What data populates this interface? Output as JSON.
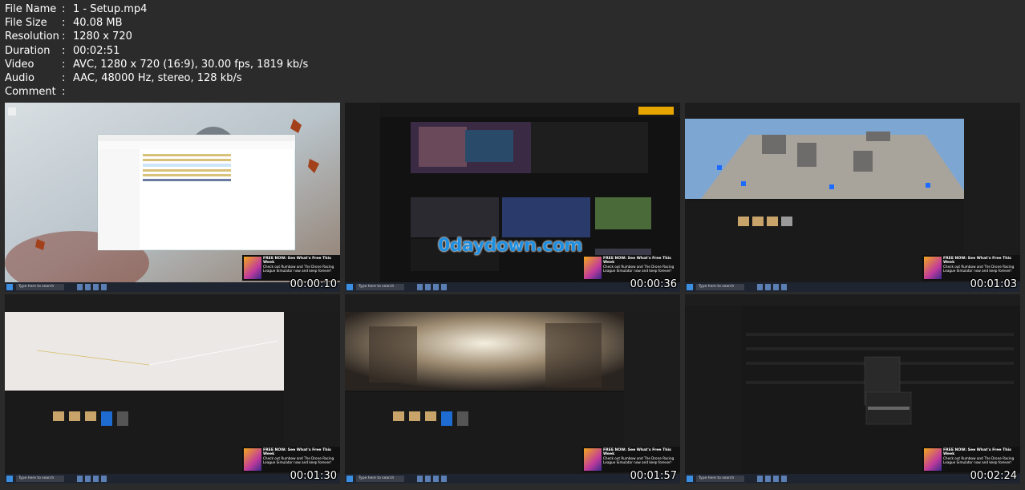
{
  "info": [
    {
      "key": "File Name",
      "value": "1 - Setup.mp4"
    },
    {
      "key": "File Size",
      "value": "40.08 MB"
    },
    {
      "key": "Resolution",
      "value": "1280 x 720"
    },
    {
      "key": "Duration",
      "value": "00:02:51"
    },
    {
      "key": "Video",
      "value": "AVC, 1280 x 720 (16:9), 30.00 fps, 1819 kb/s"
    },
    {
      "key": "Audio",
      "value": "AAC, 48000 Hz, stereo, 128 kb/s"
    },
    {
      "key": "Comment",
      "value": ""
    }
  ],
  "separator": ":",
  "thumbs": [
    {
      "timestamp": "00:00:10"
    },
    {
      "timestamp": "00:00:36"
    },
    {
      "timestamp": "00:01:03"
    },
    {
      "timestamp": "00:01:30"
    },
    {
      "timestamp": "00:01:57"
    },
    {
      "timestamp": "00:02:24"
    }
  ],
  "ad": {
    "title": "FREE NOW: See What's Free This Week",
    "body": "Check out Rumbow and The Drone Racing League Simulator now and keep forever!"
  },
  "taskbar": {
    "search_placeholder": "Type here to search"
  },
  "watermark": "0daydown.com"
}
